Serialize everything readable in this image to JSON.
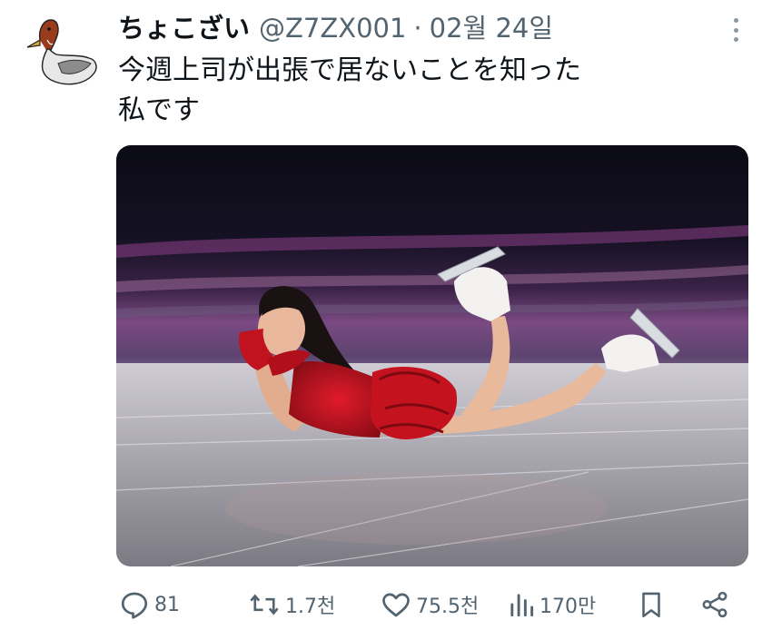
{
  "tweet": {
    "author": {
      "display_name": "ちょこざい",
      "handle": "@Z7ZX001",
      "avatar_icon": "duck-drawing-icon"
    },
    "separator": "·",
    "date": "02월 24일",
    "text_lines": [
      "今週上司が出張で居ないことを知った",
      "私です"
    ],
    "media": {
      "description_icon": "figure-skater-photo"
    },
    "actions": {
      "reply_count": "81",
      "retweet_count": "1.7천",
      "like_count": "75.5천",
      "views_count": "170만"
    }
  },
  "colors": {
    "text": "#0f1419",
    "secondary": "#536471",
    "background": "#ffffff"
  }
}
